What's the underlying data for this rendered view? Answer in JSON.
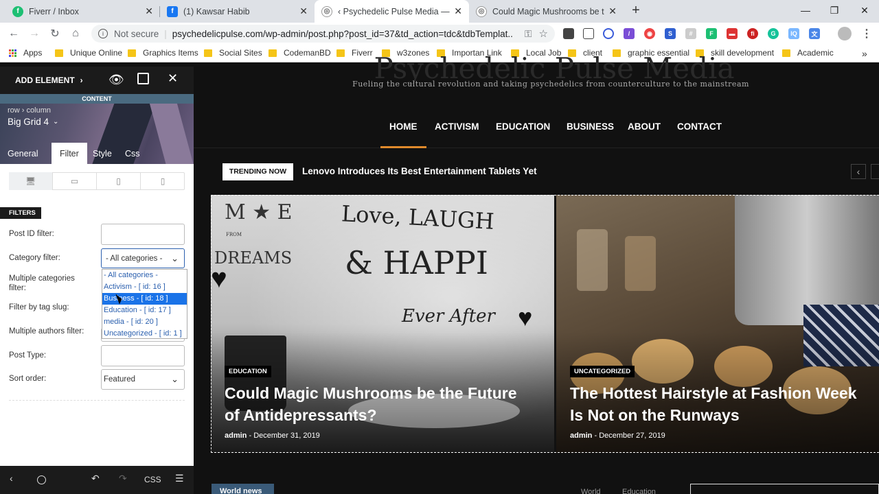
{
  "browser": {
    "tabs": [
      {
        "title": "Fiverr / Inbox",
        "fav": "f",
        "color": "#1dbf73"
      },
      {
        "title": "(1) Kawsar Habib",
        "fav": "f",
        "color": "#1877f2"
      },
      {
        "title": "‹ Psychedelic Pulse Media — Wo",
        "fav": "◎",
        "color": "#777"
      },
      {
        "title": "Could Magic Mushrooms be the",
        "fav": "◎",
        "color": "#777"
      }
    ],
    "new_tab": "+",
    "security": "Not secure",
    "url": "psychedelicpulse.com/wp-admin/post.php?post_id=37&td_action=tdc&tdbTemplat...",
    "bookmarks": [
      "Apps",
      "Unique Online",
      "Graphics Items",
      "Social Sites",
      "CodemanBD",
      "Fiverr",
      "w3zones",
      "Importan Link",
      "Local Job",
      "client",
      "graphic essential",
      "skill development",
      "Academic"
    ],
    "more": "»"
  },
  "panel": {
    "add_element": "ADD ELEMENT",
    "section_label": "CONTENT",
    "breadcrumb_row": "row",
    "breadcrumb_column": "column",
    "element_name": "Big Grid 4",
    "tabs": [
      "General",
      "Filter",
      "Style",
      "Css"
    ],
    "filters_label": "FILTERS",
    "post_id_label": "Post ID filter:",
    "category_label": "Category filter:",
    "category_value": "- All categories -",
    "multi_cat_label": "Multiple categories filter:",
    "tag_label": "Filter by tag slug:",
    "authors_label": "Multiple authors filter:",
    "post_type_label": "Post Type:",
    "sort_label": "Sort order:",
    "sort_value": "Featured",
    "dropdown_options": [
      "- All categories -",
      "Activism - [ id: 16 ]",
      "Business - [ id: 18 ]",
      "Education - [ id: 17 ]",
      "media - [ id: 20 ]",
      "Uncategorized - [ id: 1 ]"
    ],
    "selected_option_index": 2,
    "bottom_css": "CSS"
  },
  "site": {
    "logo_text": "Psychedelic Pulse Media",
    "tagline": "Fueling the cultural revolution and taking psychedelics from counterculture to the mainstream",
    "menu": [
      "HOME",
      "ACTIVISM",
      "EDUCATION",
      "BUSINESS",
      "ABOUT",
      "CONTACT"
    ],
    "active_menu": "HOME",
    "accent": "#e08a2c",
    "trending_label": "TRENDING NOW",
    "trending_text": "Lenovo Introduces Its Best Entertainment Tablets Yet",
    "card1": {
      "category": "EDUCATION",
      "title": "Could Magic Mushrooms be the Future of Antidepressants?",
      "author": "admin",
      "date": "December 31, 2019",
      "pillow_lines": [
        "M ★ E",
        "FROM",
        "DREAMS",
        "Love, LAUGH",
        "& HAPPI",
        "Ever After"
      ]
    },
    "card2": {
      "category": "UNCATEGORIZED",
      "title": "The Hottest Hairstyle at Fashion Week Is Not on the Runways",
      "author": "admin",
      "date": "December 27, 2019"
    },
    "bottom_block": "World news",
    "bottom_tabs": [
      "World",
      "Education"
    ]
  }
}
